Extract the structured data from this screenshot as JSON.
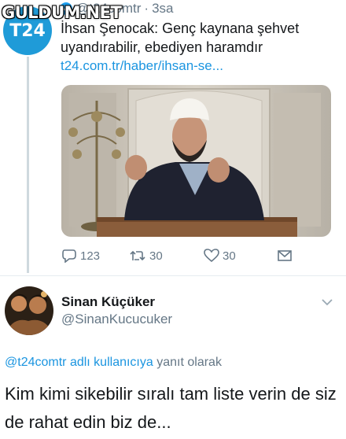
{
  "watermark": "GULDUM.NET",
  "tweet": {
    "avatar_text": "T24",
    "handle": "@t24comtr",
    "separator": "·",
    "time": "3sa",
    "text": "İhsan Şenocak: Genç kaynana şehvet uyandırabilir, ebediyen haramdır",
    "link": "t24.com.tr/haber/ihsan-se...",
    "actions": {
      "reply_count": "123",
      "retweet_count": "30",
      "like_count": "30"
    }
  },
  "reply": {
    "name": "Sinan Küçüker",
    "handle": "@SinanKucucuker",
    "replying_to_handle": "@t24comtr",
    "replying_to_mid": "adlı kullanıcıya",
    "replying_to_suffix": "yanıt olarak",
    "text": "Kim kimi sikebilir sıralı tam liste verin de siz de rahat edin biz de..."
  },
  "colors": {
    "accent": "#1da1f2",
    "link": "#1b95e0",
    "muted": "#657786",
    "brand_t24": "#1f9bd8"
  },
  "icons": [
    "reply-icon",
    "retweet-icon",
    "like-icon",
    "message-icon",
    "chevron-down-icon",
    "verified-icon"
  ]
}
